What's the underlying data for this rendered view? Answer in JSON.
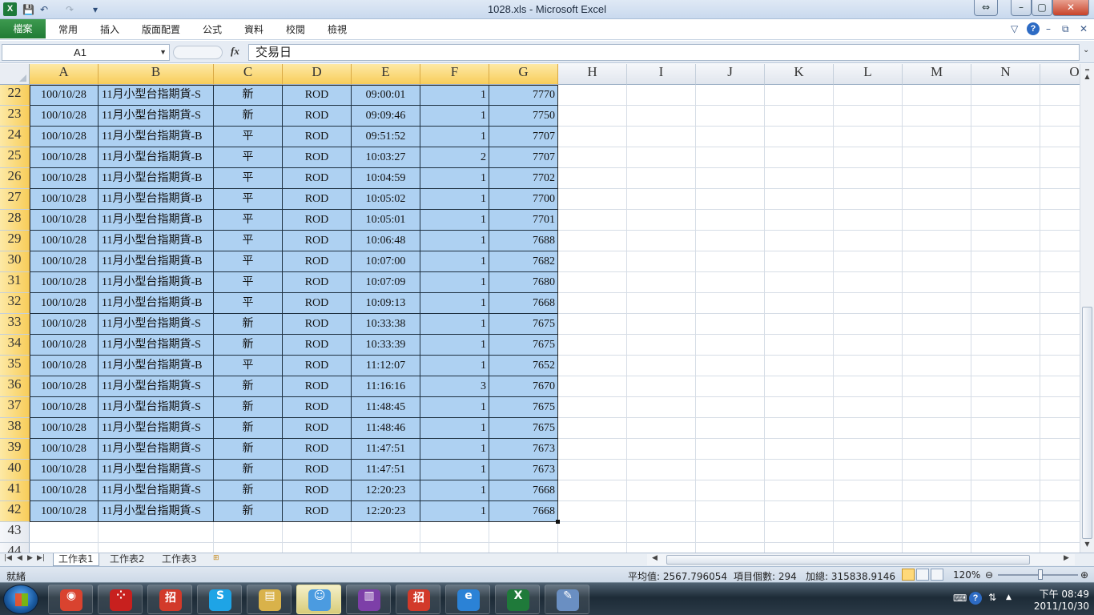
{
  "window": {
    "title": "1028.xls - Microsoft Excel",
    "buttons": [
      "⇔",
      "–",
      "▢",
      "✕"
    ]
  },
  "quick_access": {
    "app_icon": "X",
    "save": "💾",
    "undo": "↶",
    "redo": "↷",
    "customize": "▾"
  },
  "ribbon": {
    "file_tab": "檔案",
    "tabs": [
      "常用",
      "插入",
      "版面配置",
      "公式",
      "資料",
      "校閱",
      "檢視"
    ],
    "right_icons": [
      "▽",
      "?",
      "–",
      "⧉",
      "✕"
    ]
  },
  "formula_bar": {
    "name_box": "A1",
    "fx_label": "fx",
    "content": "交易日"
  },
  "columns": [
    "A",
    "B",
    "C",
    "D",
    "E",
    "F",
    "G",
    "H",
    "I",
    "J",
    "K",
    "L",
    "M",
    "N",
    "O"
  ],
  "selected_columns": [
    "A",
    "B",
    "C",
    "D",
    "E",
    "F",
    "G"
  ],
  "rows": [
    {
      "num": "22",
      "cells": [
        "100/10/28",
        "11月小型台指期貨-S",
        "新",
        "ROD",
        "09:00:01",
        "1",
        "7770"
      ]
    },
    {
      "num": "23",
      "cells": [
        "100/10/28",
        "11月小型台指期貨-S",
        "新",
        "ROD",
        "09:09:46",
        "1",
        "7750"
      ]
    },
    {
      "num": "24",
      "cells": [
        "100/10/28",
        "11月小型台指期貨-B",
        "平",
        "ROD",
        "09:51:52",
        "1",
        "7707"
      ]
    },
    {
      "num": "25",
      "cells": [
        "100/10/28",
        "11月小型台指期貨-B",
        "平",
        "ROD",
        "10:03:27",
        "2",
        "7707"
      ]
    },
    {
      "num": "26",
      "cells": [
        "100/10/28",
        "11月小型台指期貨-B",
        "平",
        "ROD",
        "10:04:59",
        "1",
        "7702"
      ]
    },
    {
      "num": "27",
      "cells": [
        "100/10/28",
        "11月小型台指期貨-B",
        "平",
        "ROD",
        "10:05:02",
        "1",
        "7700"
      ]
    },
    {
      "num": "28",
      "cells": [
        "100/10/28",
        "11月小型台指期貨-B",
        "平",
        "ROD",
        "10:05:01",
        "1",
        "7701"
      ]
    },
    {
      "num": "29",
      "cells": [
        "100/10/28",
        "11月小型台指期貨-B",
        "平",
        "ROD",
        "10:06:48",
        "1",
        "7688"
      ]
    },
    {
      "num": "30",
      "cells": [
        "100/10/28",
        "11月小型台指期貨-B",
        "平",
        "ROD",
        "10:07:00",
        "1",
        "7682"
      ]
    },
    {
      "num": "31",
      "cells": [
        "100/10/28",
        "11月小型台指期貨-B",
        "平",
        "ROD",
        "10:07:09",
        "1",
        "7680"
      ]
    },
    {
      "num": "32",
      "cells": [
        "100/10/28",
        "11月小型台指期貨-B",
        "平",
        "ROD",
        "10:09:13",
        "1",
        "7668"
      ]
    },
    {
      "num": "33",
      "cells": [
        "100/10/28",
        "11月小型台指期貨-S",
        "新",
        "ROD",
        "10:33:38",
        "1",
        "7675"
      ]
    },
    {
      "num": "34",
      "cells": [
        "100/10/28",
        "11月小型台指期貨-S",
        "新",
        "ROD",
        "10:33:39",
        "1",
        "7675"
      ]
    },
    {
      "num": "35",
      "cells": [
        "100/10/28",
        "11月小型台指期貨-B",
        "平",
        "ROD",
        "11:12:07",
        "1",
        "7652"
      ]
    },
    {
      "num": "36",
      "cells": [
        "100/10/28",
        "11月小型台指期貨-S",
        "新",
        "ROD",
        "11:16:16",
        "3",
        "7670"
      ]
    },
    {
      "num": "37",
      "cells": [
        "100/10/28",
        "11月小型台指期貨-S",
        "新",
        "ROD",
        "11:48:45",
        "1",
        "7675"
      ]
    },
    {
      "num": "38",
      "cells": [
        "100/10/28",
        "11月小型台指期貨-S",
        "新",
        "ROD",
        "11:48:46",
        "1",
        "7675"
      ]
    },
    {
      "num": "39",
      "cells": [
        "100/10/28",
        "11月小型台指期貨-S",
        "新",
        "ROD",
        "11:47:51",
        "1",
        "7673"
      ]
    },
    {
      "num": "40",
      "cells": [
        "100/10/28",
        "11月小型台指期貨-S",
        "新",
        "ROD",
        "11:47:51",
        "1",
        "7673"
      ]
    },
    {
      "num": "41",
      "cells": [
        "100/10/28",
        "11月小型台指期貨-S",
        "新",
        "ROD",
        "12:20:23",
        "1",
        "7668"
      ]
    },
    {
      "num": "42",
      "cells": [
        "100/10/28",
        "11月小型台指期貨-S",
        "新",
        "ROD",
        "12:20:23",
        "1",
        "7668"
      ]
    },
    {
      "num": "43",
      "cells": [
        "",
        "",
        "",
        "",
        "",
        "",
        ""
      ]
    },
    {
      "num": "44",
      "cells": [
        "",
        "",
        "",
        "",
        "",
        "",
        ""
      ]
    }
  ],
  "sheet_tabs": [
    "工作表1",
    "工作表2",
    "工作表3"
  ],
  "active_sheet": "工作表1",
  "status": {
    "ready": "就緒",
    "average": "平均值: 2567.796054",
    "count": "項目個數: 294",
    "sum": "加總: 315838.9146",
    "zoom": "120%"
  },
  "taskbar": {
    "apps": [
      {
        "name": "chrome-icon",
        "glyph": "◉",
        "color": "#d9432f"
      },
      {
        "name": "dice-app-icon",
        "glyph": "⁘",
        "color": "#c8201e"
      },
      {
        "name": "red-app-icon",
        "glyph": "招",
        "color": "#d23a2a"
      },
      {
        "name": "skype-icon",
        "glyph": "S",
        "color": "#1ea4e6"
      },
      {
        "name": "file-explorer-icon",
        "glyph": "▤",
        "color": "#d9b24a"
      },
      {
        "name": "messenger-icon",
        "glyph": "☺",
        "color": "#4b9be0"
      },
      {
        "name": "winrar-icon",
        "glyph": "▥",
        "color": "#7d3fa8"
      },
      {
        "name": "red-app-icon-2",
        "glyph": "招",
        "color": "#d23a2a"
      },
      {
        "name": "internet-explorer-icon",
        "glyph": "e",
        "color": "#2b82d6"
      },
      {
        "name": "excel-icon",
        "glyph": "X",
        "color": "#1f7a3a"
      },
      {
        "name": "paint-icon",
        "glyph": "✎",
        "color": "#6a8fc2"
      }
    ],
    "active_app": "messenger-icon",
    "tray_icons": [
      "⌨",
      "?",
      "⇅",
      "▲"
    ],
    "clock_time": "下午 08:49",
    "clock_date": "2011/10/30"
  }
}
